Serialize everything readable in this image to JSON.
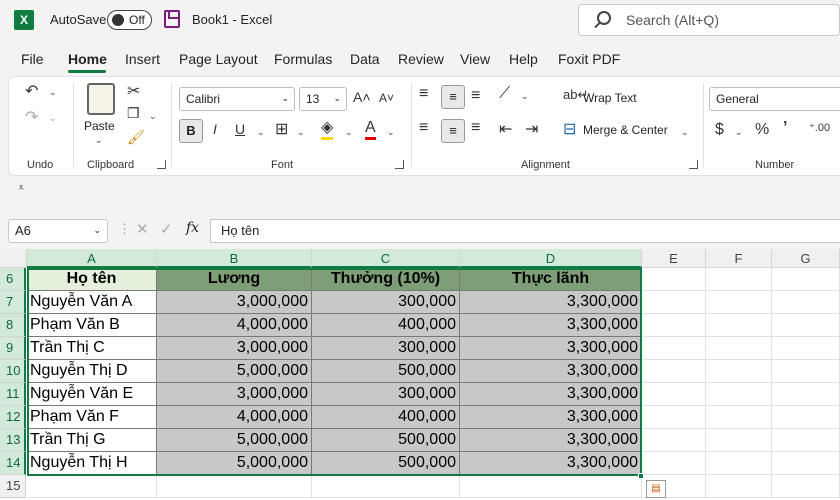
{
  "titlebar": {
    "autosave_label": "AutoSave",
    "autosave_state": "Off",
    "doc_title": "Book1  -  Excel",
    "search_placeholder": "Search (Alt+Q)"
  },
  "menu": {
    "tabs": [
      "File",
      "Home",
      "Insert",
      "Page Layout",
      "Formulas",
      "Data",
      "Review",
      "View",
      "Help",
      "Foxit PDF"
    ],
    "active": "Home"
  },
  "ribbon": {
    "groups": {
      "undo": "Undo",
      "clipboard": "Clipboard",
      "font": "Font",
      "alignment": "Alignment",
      "number": "Number"
    },
    "paste_label": "Paste",
    "font_name": "Calibri",
    "font_size": "13",
    "wrap_text": "Wrap Text",
    "merge_center": "Merge & Center",
    "number_format": "General",
    "bold": "B",
    "italic": "I",
    "underline": "U",
    "currency": "$",
    "percent": "%",
    "comma": "’"
  },
  "formula_bar": {
    "name_box": "A6",
    "fx": "fx",
    "value": "Họ tên"
  },
  "grid": {
    "columns": [
      "A",
      "B",
      "C",
      "D",
      "E",
      "F",
      "G"
    ],
    "row_numbers": [
      "6",
      "7",
      "8",
      "9",
      "10",
      "11",
      "12",
      "13",
      "14",
      "15"
    ],
    "headers": [
      "Họ tên",
      "Lương",
      "Thưởng (10%)",
      "Thực lãnh"
    ],
    "rows": [
      [
        "Nguyễn Văn A",
        "3,000,000",
        "300,000",
        "3,300,000"
      ],
      [
        "Phạm Văn B",
        "4,000,000",
        "400,000",
        "3,300,000"
      ],
      [
        "Trần Thị C",
        "3,000,000",
        "300,000",
        "3,300,000"
      ],
      [
        "Nguyễn Thị D",
        "5,000,000",
        "500,000",
        "3,300,000"
      ],
      [
        "Nguyễn Văn E",
        "3,000,000",
        "300,000",
        "3,300,000"
      ],
      [
        "Phạm Văn F",
        "4,000,000",
        "400,000",
        "3,300,000"
      ],
      [
        "Trần Thị G",
        "5,000,000",
        "500,000",
        "3,300,000"
      ],
      [
        "Nguyễn Thị H",
        "5,000,000",
        "500,000",
        "3,300,000"
      ]
    ]
  },
  "colors": {
    "accent": "#107c41",
    "header_fill": "#7e9e77",
    "body_fill": "#c8c8c8"
  }
}
